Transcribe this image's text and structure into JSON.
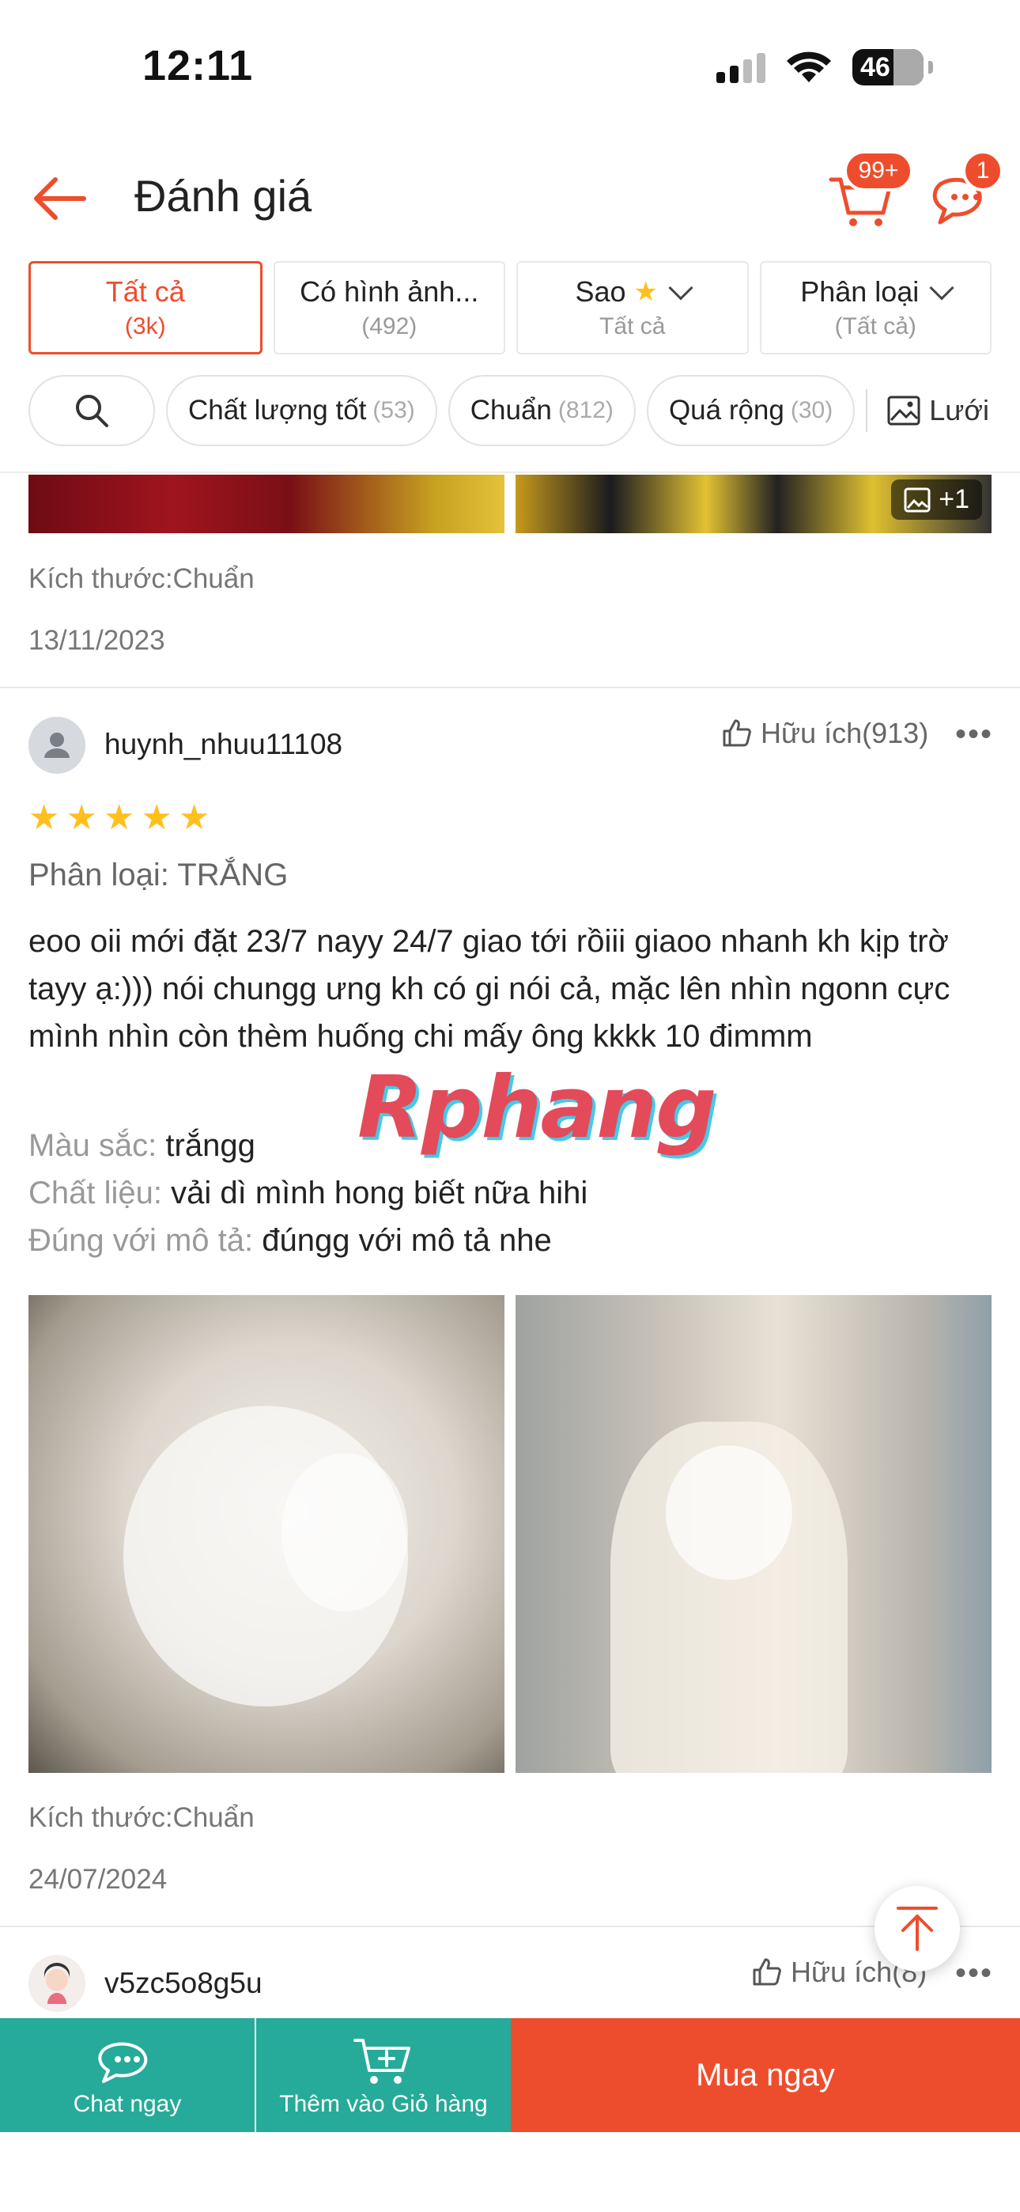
{
  "status_bar": {
    "time": "12:11",
    "battery": "46"
  },
  "header": {
    "title": "Đánh giá",
    "cart_badge": "99+",
    "chat_badge": "1"
  },
  "filter_tabs": [
    {
      "label": "Tất cả",
      "sub": "(3k)"
    },
    {
      "label": "Có hình ảnh...",
      "sub": "(492)"
    },
    {
      "label": "Sao",
      "sub": "Tất cả"
    },
    {
      "label": "Phân loại",
      "sub": "(Tất cả)"
    }
  ],
  "chips": [
    {
      "label": "Chất lượng tốt",
      "count": "(53)"
    },
    {
      "label": "Chuẩn",
      "count": "(812)"
    },
    {
      "label": "Quá rộng",
      "count": "(30)"
    }
  ],
  "grid_toggle": "Lưới",
  "prev_review": {
    "more_images": "+1",
    "size": "Kích thước:Chuẩn",
    "date": "13/11/2023"
  },
  "review": {
    "username": "huynh_nhuu11108",
    "helpful": "Hữu ích(913)",
    "rating": 5,
    "variation": "Phân loại: TRẮNG",
    "text": "eoo oii mới đặt 23/7 nayy 24/7 giao tới rồiii giaoo nhanh kh kịp trờ tayy ạ:))) nói chungg ưng kh có gi nói cả, mặc lên nhìn ngonn cực mình nhìn còn thèm huống chi mấy ông kkkk 10 đimmm",
    "attrs": [
      {
        "key": "Màu sắc:",
        "value": "trắngg"
      },
      {
        "key": "Chất liệu:",
        "value": "vải dì mình hong biết nữa hihi"
      },
      {
        "key": "Đúng với mô tả:",
        "value": "đúngg với mô tả nhe"
      }
    ],
    "size": "Kích thước:Chuẩn",
    "date": "24/07/2024"
  },
  "next_review": {
    "username": "v5zc5o8g5u",
    "helpful": "Hữu ích(8)"
  },
  "watermark": "Rphang",
  "bottom_bar": {
    "chat": "Chat ngay",
    "add_cart": "Thêm vào Giỏ hàng",
    "buy": "Mua ngay"
  },
  "colors": {
    "accent": "#ee4d2d",
    "teal": "#26aa99",
    "star": "#ffbf1f"
  }
}
